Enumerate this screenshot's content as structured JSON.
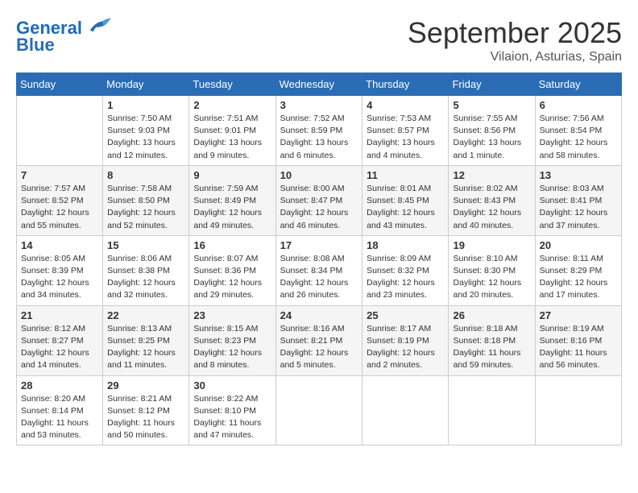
{
  "header": {
    "logo_line1": "General",
    "logo_line2": "Blue",
    "month": "September 2025",
    "location": "Vilaion, Asturias, Spain"
  },
  "weekdays": [
    "Sunday",
    "Monday",
    "Tuesday",
    "Wednesday",
    "Thursday",
    "Friday",
    "Saturday"
  ],
  "weeks": [
    [
      {
        "day": "",
        "sunrise": "",
        "sunset": "",
        "daylight": ""
      },
      {
        "day": "1",
        "sunrise": "Sunrise: 7:50 AM",
        "sunset": "Sunset: 9:03 PM",
        "daylight": "Daylight: 13 hours and 12 minutes."
      },
      {
        "day": "2",
        "sunrise": "Sunrise: 7:51 AM",
        "sunset": "Sunset: 9:01 PM",
        "daylight": "Daylight: 13 hours and 9 minutes."
      },
      {
        "day": "3",
        "sunrise": "Sunrise: 7:52 AM",
        "sunset": "Sunset: 8:59 PM",
        "daylight": "Daylight: 13 hours and 6 minutes."
      },
      {
        "day": "4",
        "sunrise": "Sunrise: 7:53 AM",
        "sunset": "Sunset: 8:57 PM",
        "daylight": "Daylight: 13 hours and 4 minutes."
      },
      {
        "day": "5",
        "sunrise": "Sunrise: 7:55 AM",
        "sunset": "Sunset: 8:56 PM",
        "daylight": "Daylight: 13 hours and 1 minute."
      },
      {
        "day": "6",
        "sunrise": "Sunrise: 7:56 AM",
        "sunset": "Sunset: 8:54 PM",
        "daylight": "Daylight: 12 hours and 58 minutes."
      }
    ],
    [
      {
        "day": "7",
        "sunrise": "Sunrise: 7:57 AM",
        "sunset": "Sunset: 8:52 PM",
        "daylight": "Daylight: 12 hours and 55 minutes."
      },
      {
        "day": "8",
        "sunrise": "Sunrise: 7:58 AM",
        "sunset": "Sunset: 8:50 PM",
        "daylight": "Daylight: 12 hours and 52 minutes."
      },
      {
        "day": "9",
        "sunrise": "Sunrise: 7:59 AM",
        "sunset": "Sunset: 8:49 PM",
        "daylight": "Daylight: 12 hours and 49 minutes."
      },
      {
        "day": "10",
        "sunrise": "Sunrise: 8:00 AM",
        "sunset": "Sunset: 8:47 PM",
        "daylight": "Daylight: 12 hours and 46 minutes."
      },
      {
        "day": "11",
        "sunrise": "Sunrise: 8:01 AM",
        "sunset": "Sunset: 8:45 PM",
        "daylight": "Daylight: 12 hours and 43 minutes."
      },
      {
        "day": "12",
        "sunrise": "Sunrise: 8:02 AM",
        "sunset": "Sunset: 8:43 PM",
        "daylight": "Daylight: 12 hours and 40 minutes."
      },
      {
        "day": "13",
        "sunrise": "Sunrise: 8:03 AM",
        "sunset": "Sunset: 8:41 PM",
        "daylight": "Daylight: 12 hours and 37 minutes."
      }
    ],
    [
      {
        "day": "14",
        "sunrise": "Sunrise: 8:05 AM",
        "sunset": "Sunset: 8:39 PM",
        "daylight": "Daylight: 12 hours and 34 minutes."
      },
      {
        "day": "15",
        "sunrise": "Sunrise: 8:06 AM",
        "sunset": "Sunset: 8:38 PM",
        "daylight": "Daylight: 12 hours and 32 minutes."
      },
      {
        "day": "16",
        "sunrise": "Sunrise: 8:07 AM",
        "sunset": "Sunset: 8:36 PM",
        "daylight": "Daylight: 12 hours and 29 minutes."
      },
      {
        "day": "17",
        "sunrise": "Sunrise: 8:08 AM",
        "sunset": "Sunset: 8:34 PM",
        "daylight": "Daylight: 12 hours and 26 minutes."
      },
      {
        "day": "18",
        "sunrise": "Sunrise: 8:09 AM",
        "sunset": "Sunset: 8:32 PM",
        "daylight": "Daylight: 12 hours and 23 minutes."
      },
      {
        "day": "19",
        "sunrise": "Sunrise: 8:10 AM",
        "sunset": "Sunset: 8:30 PM",
        "daylight": "Daylight: 12 hours and 20 minutes."
      },
      {
        "day": "20",
        "sunrise": "Sunrise: 8:11 AM",
        "sunset": "Sunset: 8:29 PM",
        "daylight": "Daylight: 12 hours and 17 minutes."
      }
    ],
    [
      {
        "day": "21",
        "sunrise": "Sunrise: 8:12 AM",
        "sunset": "Sunset: 8:27 PM",
        "daylight": "Daylight: 12 hours and 14 minutes."
      },
      {
        "day": "22",
        "sunrise": "Sunrise: 8:13 AM",
        "sunset": "Sunset: 8:25 PM",
        "daylight": "Daylight: 12 hours and 11 minutes."
      },
      {
        "day": "23",
        "sunrise": "Sunrise: 8:15 AM",
        "sunset": "Sunset: 8:23 PM",
        "daylight": "Daylight: 12 hours and 8 minutes."
      },
      {
        "day": "24",
        "sunrise": "Sunrise: 8:16 AM",
        "sunset": "Sunset: 8:21 PM",
        "daylight": "Daylight: 12 hours and 5 minutes."
      },
      {
        "day": "25",
        "sunrise": "Sunrise: 8:17 AM",
        "sunset": "Sunset: 8:19 PM",
        "daylight": "Daylight: 12 hours and 2 minutes."
      },
      {
        "day": "26",
        "sunrise": "Sunrise: 8:18 AM",
        "sunset": "Sunset: 8:18 PM",
        "daylight": "Daylight: 11 hours and 59 minutes."
      },
      {
        "day": "27",
        "sunrise": "Sunrise: 8:19 AM",
        "sunset": "Sunset: 8:16 PM",
        "daylight": "Daylight: 11 hours and 56 minutes."
      }
    ],
    [
      {
        "day": "28",
        "sunrise": "Sunrise: 8:20 AM",
        "sunset": "Sunset: 8:14 PM",
        "daylight": "Daylight: 11 hours and 53 minutes."
      },
      {
        "day": "29",
        "sunrise": "Sunrise: 8:21 AM",
        "sunset": "Sunset: 8:12 PM",
        "daylight": "Daylight: 11 hours and 50 minutes."
      },
      {
        "day": "30",
        "sunrise": "Sunrise: 8:22 AM",
        "sunset": "Sunset: 8:10 PM",
        "daylight": "Daylight: 11 hours and 47 minutes."
      },
      {
        "day": "",
        "sunrise": "",
        "sunset": "",
        "daylight": ""
      },
      {
        "day": "",
        "sunrise": "",
        "sunset": "",
        "daylight": ""
      },
      {
        "day": "",
        "sunrise": "",
        "sunset": "",
        "daylight": ""
      },
      {
        "day": "",
        "sunrise": "",
        "sunset": "",
        "daylight": ""
      }
    ]
  ]
}
